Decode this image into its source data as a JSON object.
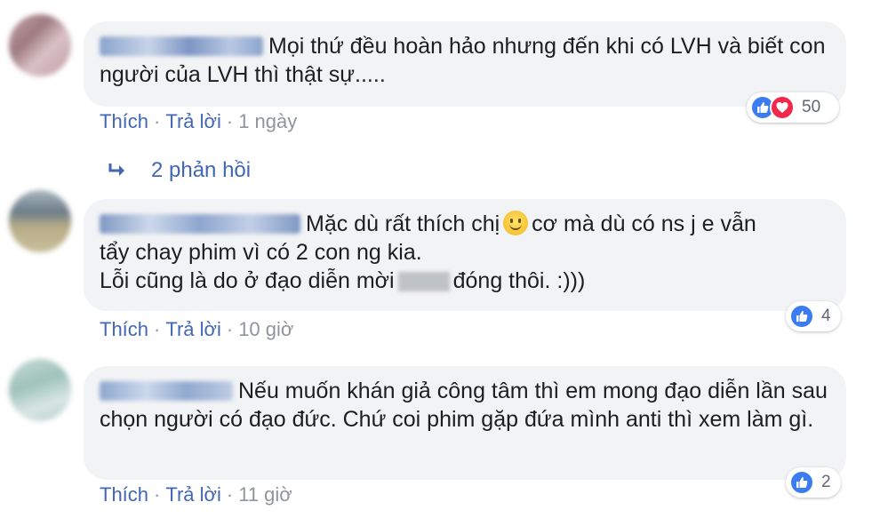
{
  "comments": [
    {
      "text": "Mọi thứ đều hoàn hảo nhưng đến khi có LVH và biết con người của LVH thì thật sự.....",
      "reaction_count": "50",
      "actions": {
        "like": "Thích",
        "reply": "Trả lời",
        "time": "1 ngày"
      }
    },
    {
      "text_line1_a": "Mặc dù rất thích chị",
      "text_line1_b": "cơ mà dù có ns j e vẫn",
      "text_line2": "tẩy chay phim vì có 2 con ng kia.",
      "text_line3_a": "Lỗi cũng là do ở đạo diễn mời",
      "text_line3_b": "đóng thôi. :)))",
      "reaction_count": "4",
      "actions": {
        "like": "Thích",
        "reply": "Trả lời",
        "time": "10 giờ"
      }
    },
    {
      "text": "Nếu muốn khán giả công tâm thì em mong đạo diễn lần sau chọn người có đạo đức. Chứ coi phim gặp đứa mình anti thì xem làm gì.",
      "reaction_count": "2",
      "actions": {
        "like": "Thích",
        "reply": "Trả lời",
        "time": "11 giờ"
      }
    }
  ],
  "replies_link": "2 phản hồi",
  "separator": "·",
  "colors": {
    "link": "#4267b2",
    "bubble": "#f2f3f5",
    "like": "#3b7df0",
    "love": "#f0284a",
    "meta": "#90949c"
  },
  "icons": {
    "like": "thumbs-up-icon",
    "love": "heart-icon",
    "reply": "reply-arrow-icon",
    "emoji": "smiley-emoji-icon"
  }
}
